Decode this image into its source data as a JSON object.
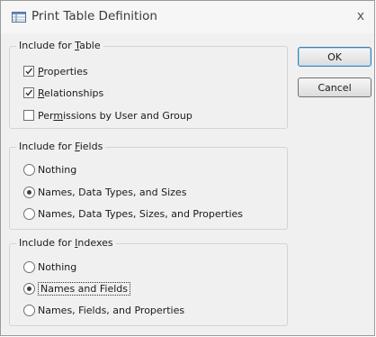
{
  "window": {
    "title": "Print Table Definition",
    "close_glyph": "x",
    "icon": "table-definition-icon"
  },
  "groups": {
    "table": {
      "legend": "Include for Table",
      "items": [
        {
          "label": "Properties",
          "checked": true
        },
        {
          "label": "Relationships",
          "checked": true
        },
        {
          "label": "Permissions by User and Group",
          "checked": false
        }
      ]
    },
    "fields": {
      "legend": "Include for Fields",
      "options": [
        {
          "label": "Nothing",
          "selected": false
        },
        {
          "label": "Names, Data Types, and Sizes",
          "selected": true
        },
        {
          "label": "Names, Data Types, Sizes, and Properties",
          "selected": false
        }
      ]
    },
    "indexes": {
      "legend": "Include for Indexes",
      "options": [
        {
          "label": "Nothing",
          "selected": false
        },
        {
          "label": "Names and Fields",
          "selected": true
        },
        {
          "label": "Names, Fields, and Properties",
          "selected": false
        }
      ]
    }
  },
  "buttons": {
    "ok": "OK",
    "cancel": "Cancel"
  },
  "colors": {
    "dialog_bg": "#f0f0f0",
    "default_button_border": "#3c7fb1"
  }
}
